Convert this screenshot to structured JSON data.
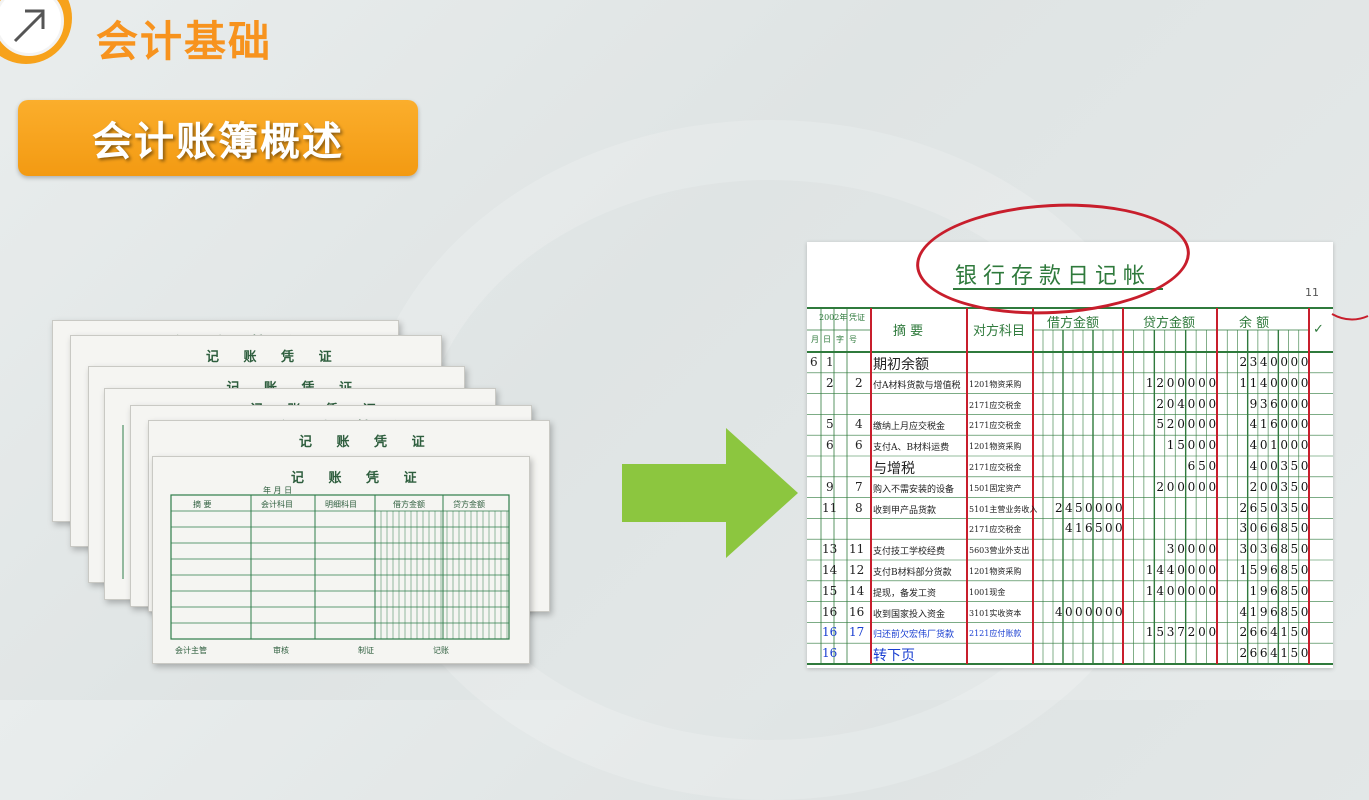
{
  "header": {
    "title": "会计基础",
    "section": "会计账簿概述"
  },
  "voucher": {
    "title": "记 账 凭 证",
    "cols": [
      "摘  要",
      "会计科目",
      "明细科目",
      "借方金额",
      "贷方金额"
    ],
    "footer": [
      "会计主管",
      "审核",
      "制证",
      "记账"
    ],
    "date_labels": [
      "年",
      "月",
      "日",
      "字",
      "号"
    ]
  },
  "ledger": {
    "title": "银行存款日记帐",
    "page_no": "11",
    "headers": {
      "date": "2002年",
      "voucher": "凭证",
      "summary": "摘   要",
      "account": "对方科目",
      "debit": "借方金额",
      "credit": "贷方金额",
      "balance": "余   额",
      "check": "✓"
    },
    "subheaders": {
      "month": "月",
      "day": "日",
      "kind": "字",
      "num": "号"
    },
    "rows": [
      {
        "m": "6",
        "d": "1",
        "n": "",
        "summary": "期初余额",
        "account": "",
        "debit": "",
        "credit": "",
        "balance": "2340000"
      },
      {
        "m": "",
        "d": "2",
        "n": "2",
        "summary": "付A材料货款与增值税",
        "account": "1201物资采购",
        "debit": "",
        "credit": "1200000",
        "balance": "1140000"
      },
      {
        "m": "",
        "d": "",
        "n": "",
        "summary": "",
        "account": "2171应交税金",
        "debit": "",
        "credit": "204000",
        "balance": "936000"
      },
      {
        "m": "",
        "d": "5",
        "n": "4",
        "summary": "缴纳上月应交税金",
        "account": "2171应交税金",
        "debit": "",
        "credit": "520000",
        "balance": "416000"
      },
      {
        "m": "",
        "d": "6",
        "n": "6",
        "summary": "支付A、B材料运费",
        "account": "1201物资采购",
        "debit": "",
        "credit": "15000",
        "balance": "401000"
      },
      {
        "m": "",
        "d": "",
        "n": "",
        "summary": "与增税",
        "account": "2171应交税金",
        "debit": "",
        "credit": "650",
        "balance": "400350"
      },
      {
        "m": "",
        "d": "9",
        "n": "7",
        "summary": "购入不需安装的设备",
        "account": "1501固定资产",
        "debit": "",
        "credit": "200000",
        "balance": "200350"
      },
      {
        "m": "",
        "d": "11",
        "n": "8",
        "summary": "收到甲产品货款",
        "account": "5101主营业务收入",
        "debit": "2450000",
        "credit": "",
        "balance": "2650350"
      },
      {
        "m": "",
        "d": "",
        "n": "",
        "summary": "",
        "account": "2171应交税金",
        "debit": "416500",
        "credit": "",
        "balance": "3066850"
      },
      {
        "m": "",
        "d": "13",
        "n": "11",
        "summary": "支付技工学校经费",
        "account": "5603营业外支出",
        "debit": "",
        "credit": "30000",
        "balance": "3036850"
      },
      {
        "m": "",
        "d": "14",
        "n": "12",
        "summary": "支付B材料部分货款",
        "account": "1201物资采购",
        "debit": "",
        "credit": "1440000",
        "balance": "1596850"
      },
      {
        "m": "",
        "d": "15",
        "n": "14",
        "summary": "提现，备发工资",
        "account": "1001现金",
        "debit": "",
        "credit": "1400000",
        "balance": "196850"
      },
      {
        "m": "",
        "d": "16",
        "n": "16",
        "summary": "收到国家投入资金",
        "account": "3101实收资本",
        "debit": "4000000",
        "credit": "",
        "balance": "4196850"
      },
      {
        "m": "",
        "d": "16",
        "n": "17",
        "summary": "归还前欠宏伟厂货款",
        "account": "2121应付账款",
        "debit": "",
        "credit": "1537200",
        "balance": "2664150",
        "blue": true
      },
      {
        "m": "",
        "d": "16",
        "n": "",
        "summary": "转下页",
        "account": "",
        "debit": "",
        "credit": "",
        "balance": "2664150",
        "blue": true
      }
    ]
  },
  "colors": {
    "orange": "#f7931e",
    "green": "#2f7a3c",
    "red": "#c81e2c",
    "arrow": "#8cc63f"
  }
}
